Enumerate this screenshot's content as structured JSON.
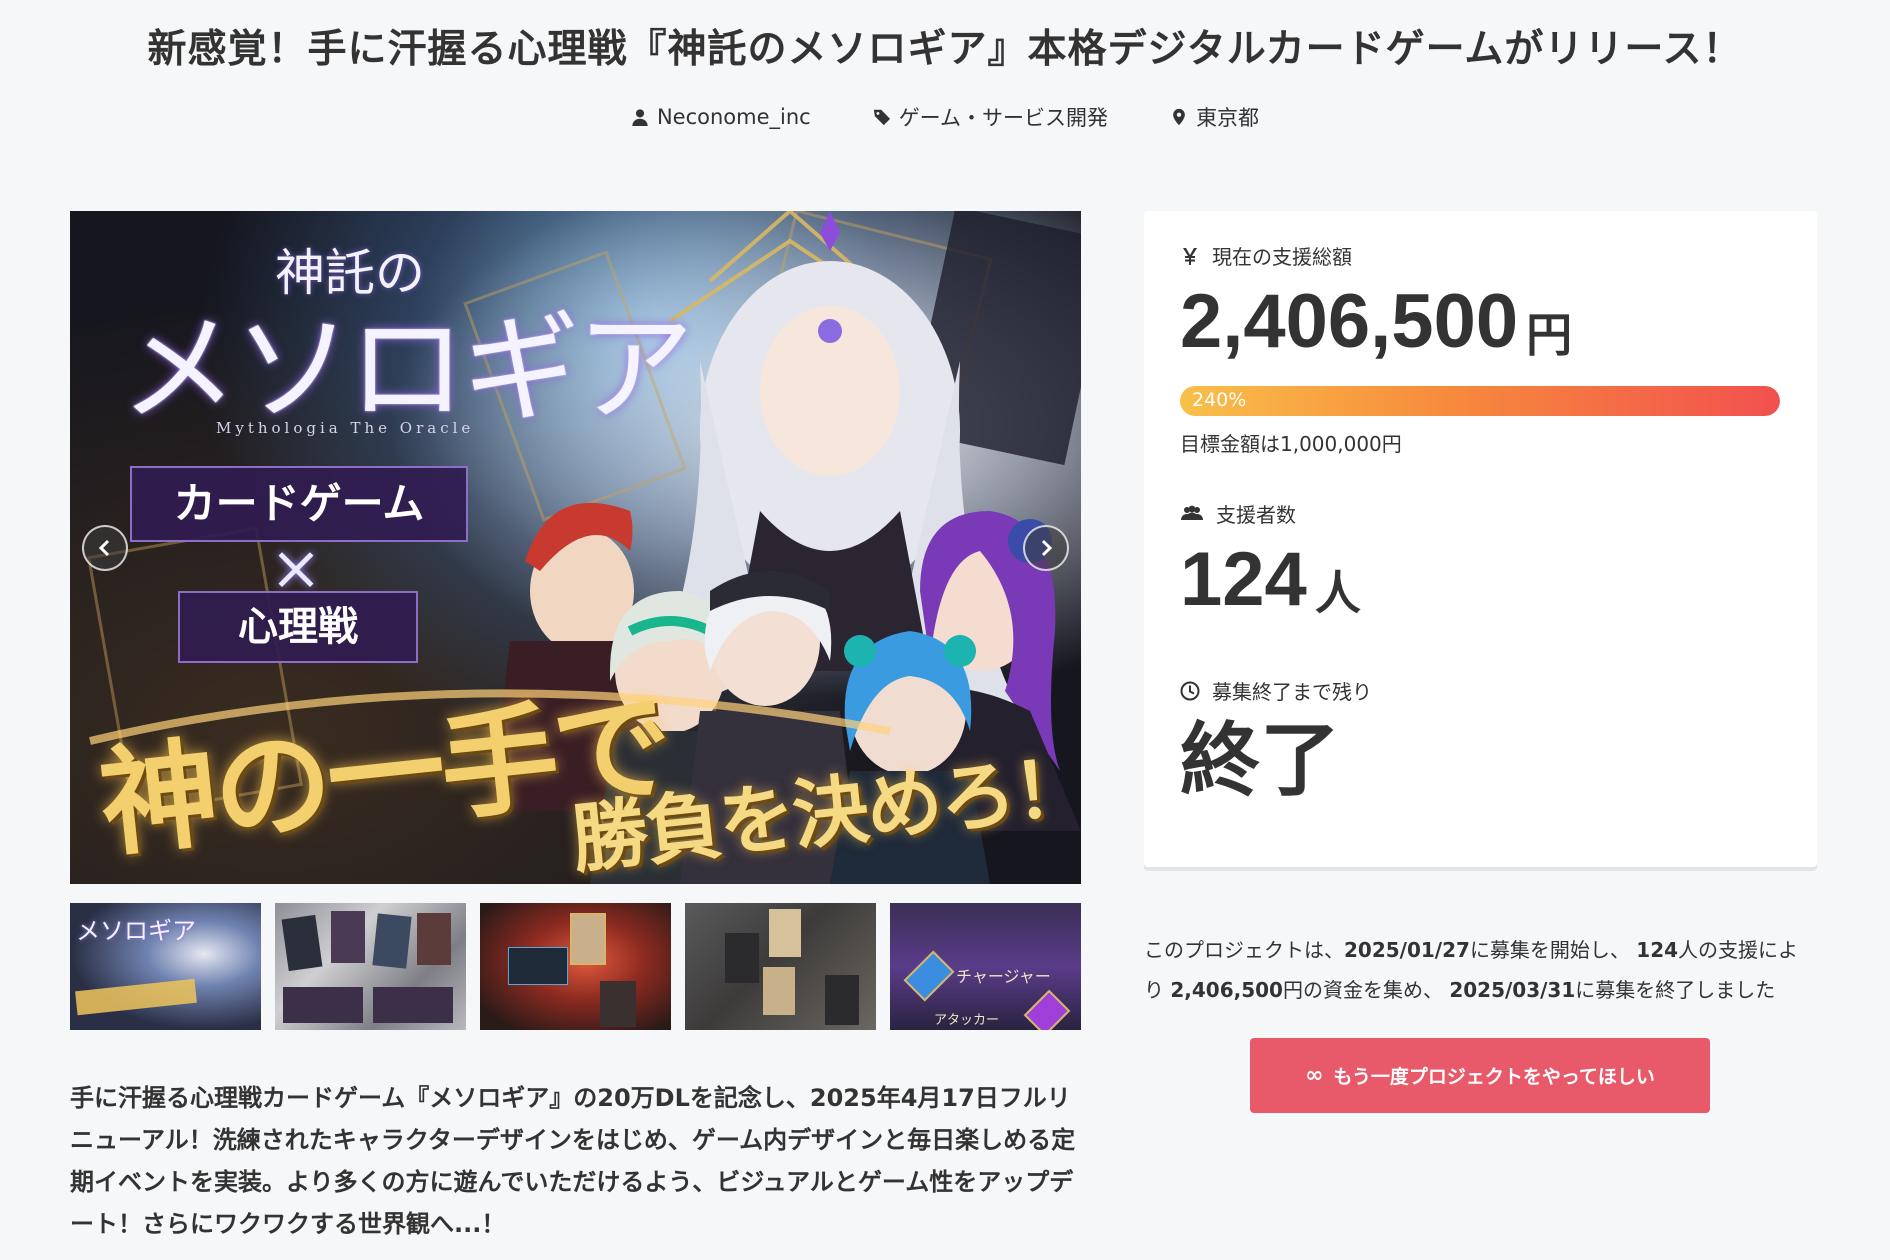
{
  "project": {
    "title": "新感覚！手に汗握る心理戦『神託のメソロギア』本格デジタルカードゲームがリリース！",
    "owner": "Neconome_inc",
    "category": "ゲーム・サービス開発",
    "location": "東京都"
  },
  "hero": {
    "logo_small": "神託の",
    "logo_big": "メソロギア",
    "logo_sub": "Mythologia The Oracle",
    "banner1": "カードゲーム",
    "cross": "×",
    "banner2": "心理戦",
    "slogan1": "神の一手で",
    "slogan2": "勝負を決めろ！"
  },
  "thumbnails": [
    {
      "label": "メソロギア"
    },
    {
      "label": ""
    },
    {
      "label": ""
    },
    {
      "label": ""
    },
    {
      "label": "チャージャー"
    }
  ],
  "thumb_extra": {
    "t5_label2": "アタッカー"
  },
  "description": "手に汗握る心理戦カードゲーム『メソロギア』の20万DLを記念し、2025年4月17日フルリニューアル！洗練されたキャラクターデザインをはじめ、ゲーム内デザインと毎日楽しめる定期イベントを実装。より多くの方に遊んでいただけるよう、ビジュアルとゲーム性をアップデート！さらにワクワクする世界観へ...！",
  "stats": {
    "amount_label": "現在の支援総額",
    "amount": "2,406,500",
    "amount_unit": "円",
    "progress_text": "240%",
    "progress_percent": 240,
    "goal_text": "目標金額は1,000,000円",
    "supporters_label": "支援者数",
    "supporters": "124",
    "supporters_unit": "人",
    "remain_label": "募集終了まで残り",
    "remain_value": "終了"
  },
  "summary": {
    "p1": "このプロジェクトは、",
    "start_date": "2025/01/27",
    "p2": "に募集を開始し、",
    "count": "124",
    "p3": "人の支援により",
    "amount": "2,406,500",
    "p4": "円の資金を集め、",
    "end_date": "2025/03/31",
    "p5": "に募集を終了しました"
  },
  "again_button": {
    "icon": "infinity-icon",
    "label": "もう一度プロジェクトをやってほしい"
  },
  "colors": {
    "accent": "#e8596a",
    "progress_start": "#f8c04a",
    "progress_end": "#f2504f",
    "background": "#f6f7f9"
  }
}
